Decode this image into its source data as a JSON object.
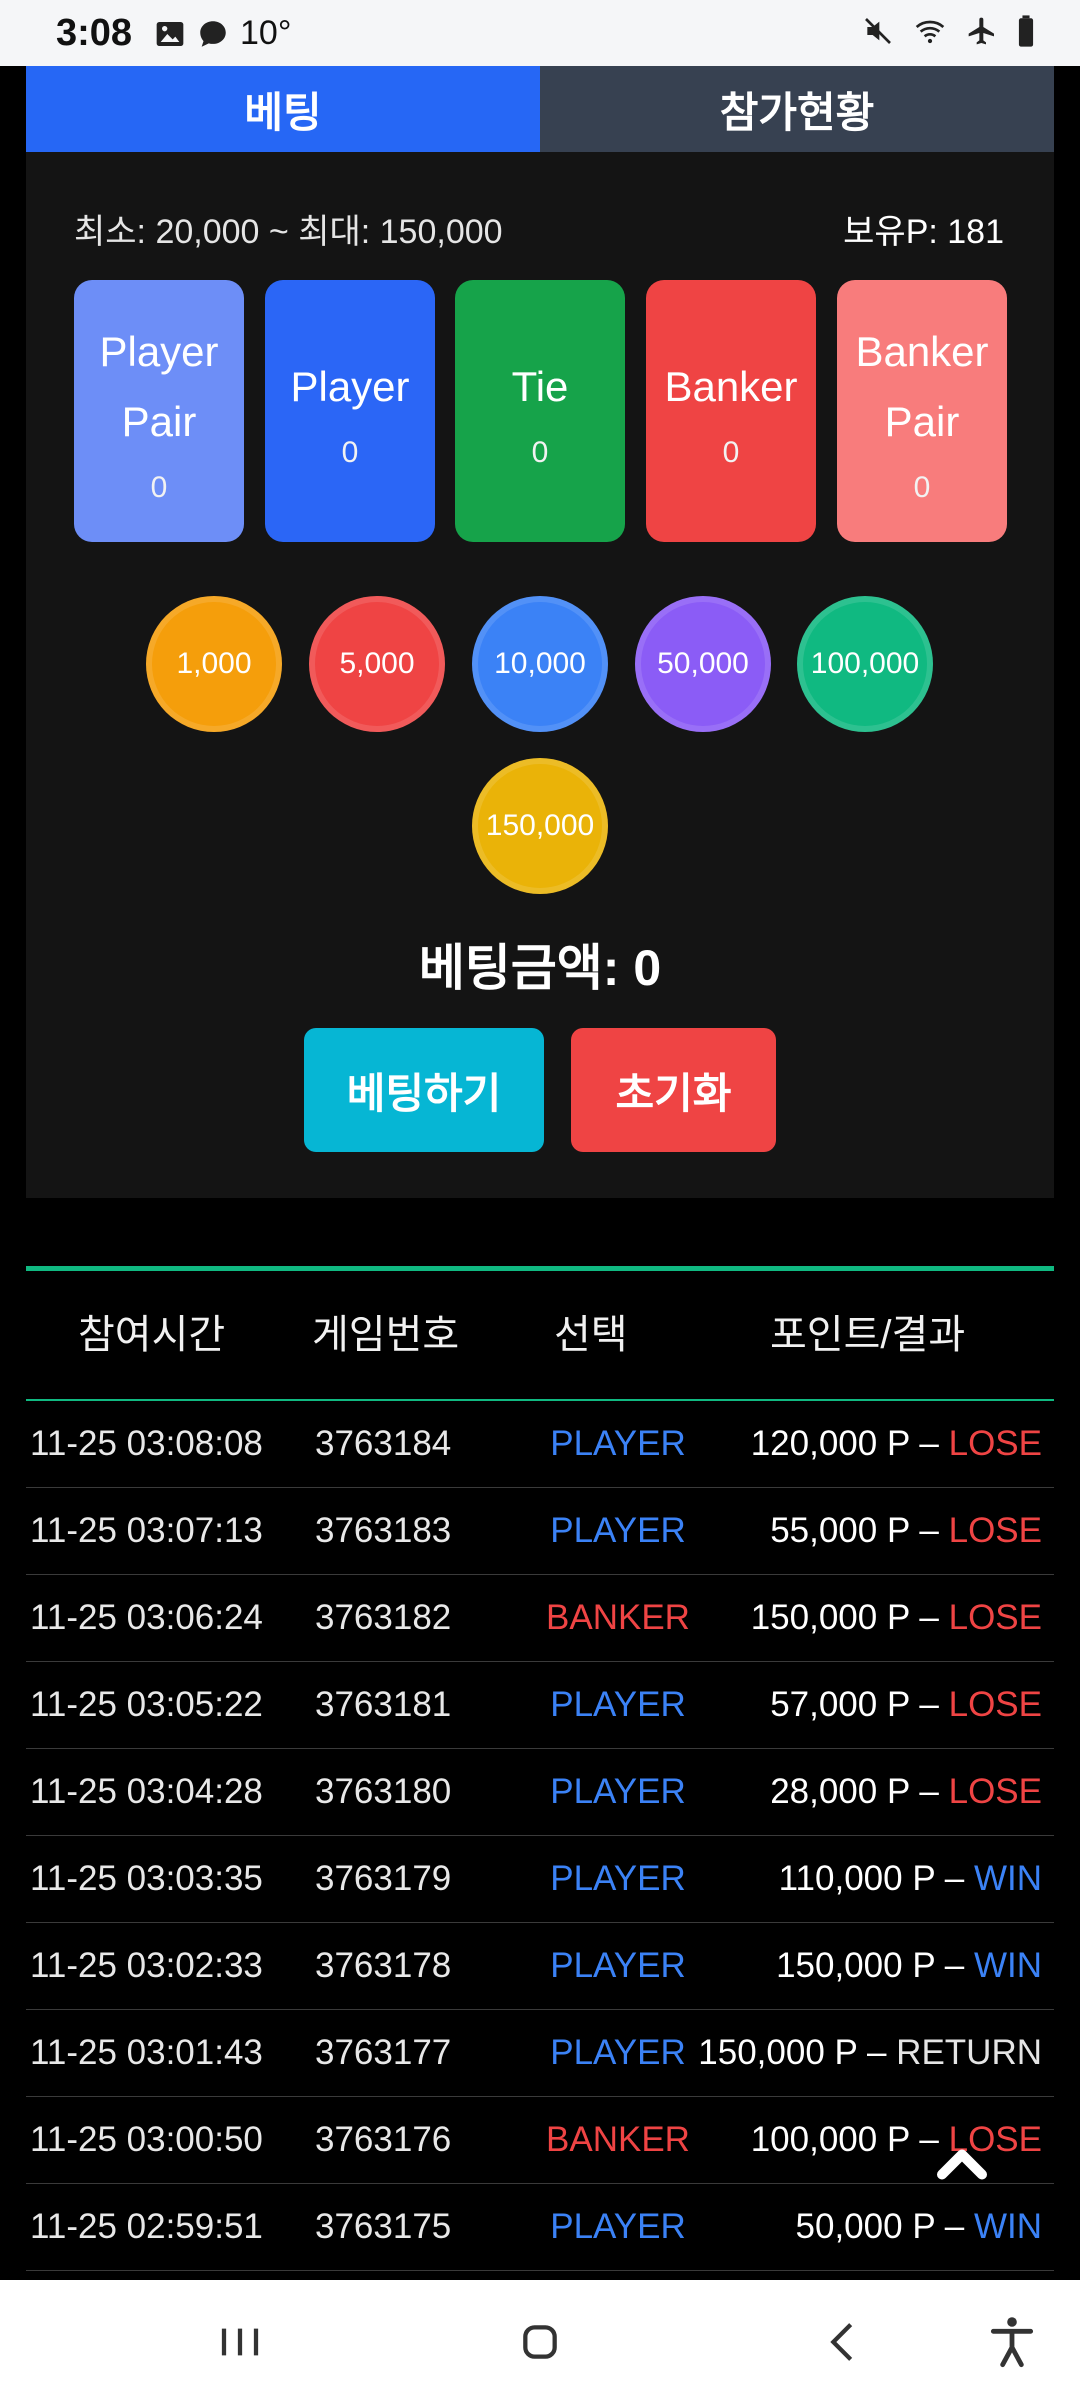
{
  "status": {
    "time": "3:08",
    "temperature": "10°",
    "icons_left": [
      "image-icon",
      "chat-bubble-icon"
    ],
    "icons_right": [
      "mute-icon",
      "wifi-icon",
      "airplane-icon",
      "battery-icon"
    ]
  },
  "tabs": [
    {
      "label": "베팅",
      "active": true
    },
    {
      "label": "참가현황",
      "active": false
    }
  ],
  "limits_text": "최소: 20,000 ~ 최대: 150,000",
  "points_text": "보유P: 181",
  "bet_options": [
    {
      "label": "Player\nPair",
      "amount": "0",
      "color": "#6d8ef7"
    },
    {
      "label": "Player",
      "amount": "0",
      "color": "#2b66f6"
    },
    {
      "label": "Tie",
      "amount": "0",
      "color": "#16a34a"
    },
    {
      "label": "Banker",
      "amount": "0",
      "color": "#ef4444"
    },
    {
      "label": "Banker\nPair",
      "amount": "0",
      "color": "#f87c7c"
    }
  ],
  "chips": [
    {
      "label": "1,000",
      "color": "#f59e0b"
    },
    {
      "label": "5,000",
      "color": "#ef4444"
    },
    {
      "label": "10,000",
      "color": "#3b82f6"
    },
    {
      "label": "50,000",
      "color": "#8b5cf6"
    },
    {
      "label": "100,000",
      "color": "#10b981"
    },
    {
      "label": "150,000",
      "color": "#eab308"
    }
  ],
  "bet_total": "베팅금액: 0",
  "buttons": {
    "bet": {
      "label": "베팅하기",
      "color": "#06b6d4"
    },
    "reset": {
      "label": "초기화",
      "color": "#ef4444"
    }
  },
  "history": {
    "headers": [
      "참여시간",
      "게임번호",
      "선택",
      "포인트/결과"
    ],
    "rows": [
      {
        "time": "11-25 03:08:08",
        "game": "3763184",
        "pick": "PLAYER",
        "points": "120,000",
        "unit": " P – ",
        "result": "LOSE"
      },
      {
        "time": "11-25 03:07:13",
        "game": "3763183",
        "pick": "PLAYER",
        "points": "55,000",
        "unit": " P – ",
        "result": "LOSE"
      },
      {
        "time": "11-25 03:06:24",
        "game": "3763182",
        "pick": "BANKER",
        "points": "150,000",
        "unit": " P – ",
        "result": "LOSE"
      },
      {
        "time": "11-25 03:05:22",
        "game": "3763181",
        "pick": "PLAYER",
        "points": "57,000",
        "unit": " P – ",
        "result": "LOSE"
      },
      {
        "time": "11-25 03:04:28",
        "game": "3763180",
        "pick": "PLAYER",
        "points": "28,000",
        "unit": " P – ",
        "result": "LOSE"
      },
      {
        "time": "11-25 03:03:35",
        "game": "3763179",
        "pick": "PLAYER",
        "points": "110,000",
        "unit": " P – ",
        "result": "WIN"
      },
      {
        "time": "11-25 03:02:33",
        "game": "3763178",
        "pick": "PLAYER",
        "points": "150,000",
        "unit": " P – ",
        "result": "WIN"
      },
      {
        "time": "11-25 03:01:43",
        "game": "3763177",
        "pick": "PLAYER",
        "points": "150,000",
        "unit": " P – ",
        "result": "RETURN"
      },
      {
        "time": "11-25 03:00:50",
        "game": "3763176",
        "pick": "BANKER",
        "points": "100,000",
        "unit": " P – ",
        "result": "LOSE"
      },
      {
        "time": "11-25 02:59:51",
        "game": "3763175",
        "pick": "PLAYER",
        "points": "50,000",
        "unit": " P – ",
        "result": "WIN"
      }
    ]
  },
  "nav": [
    "recent-apps-icon",
    "home-icon",
    "back-icon",
    "accessibility-icon"
  ]
}
